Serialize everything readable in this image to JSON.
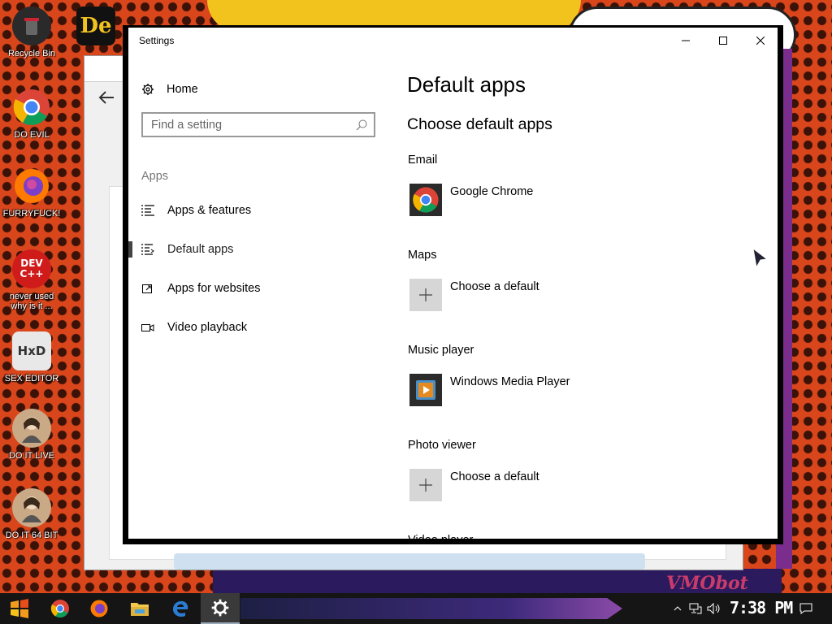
{
  "desktop": {
    "icons": [
      {
        "label": "Recycle Bin",
        "color": "#2a2a2a"
      },
      {
        "label": "DO EVIL",
        "color": "#ffffff"
      },
      {
        "label": "FURRYFUCK!",
        "color": "#ff8a00"
      },
      {
        "label": "never used why is it ...",
        "color": "#d01b1b"
      },
      {
        "label": "SEX EDITOR",
        "color": "#dddddd"
      },
      {
        "label": "DO IT LIVE",
        "color": "#c9a27a"
      },
      {
        "label": "DO IT 64 BIT",
        "color": "#c9a27a"
      }
    ],
    "dev_icon_text": "DEV C++",
    "hxd_icon_text": "HxD",
    "de_icon_text": "De",
    "wallpaper_text": "VMObot"
  },
  "settings": {
    "window_title": "Settings",
    "nav": {
      "home_label": "Home",
      "search_placeholder": "Find a setting",
      "section_label": "Apps",
      "items": [
        {
          "label": "Apps & features",
          "icon": "list-icon"
        },
        {
          "label": "Default apps",
          "icon": "default-apps-icon",
          "selected": true
        },
        {
          "label": "Apps for websites",
          "icon": "open-window-icon"
        },
        {
          "label": "Video playback",
          "icon": "video-camera-icon"
        }
      ]
    },
    "main": {
      "page_title": "Default apps",
      "section_title": "Choose default apps",
      "categories": [
        {
          "label": "Email",
          "app": "Google Chrome",
          "icon": "chrome-icon"
        },
        {
          "label": "Maps",
          "app": "Choose a default",
          "icon": "plus-icon"
        },
        {
          "label": "Music player",
          "app": "Windows Media Player",
          "icon": "media-player-icon"
        },
        {
          "label": "Photo viewer",
          "app": "Choose a default",
          "icon": "plus-icon"
        },
        {
          "label": "Video player",
          "app": "",
          "icon": ""
        }
      ]
    }
  },
  "taskbar": {
    "clock": "7:38 PM"
  }
}
